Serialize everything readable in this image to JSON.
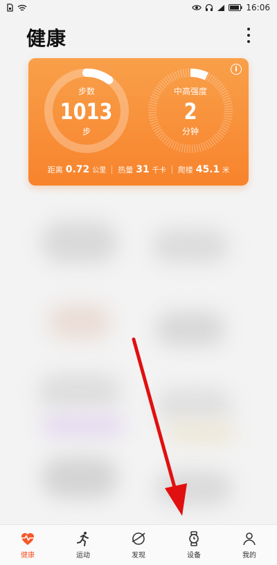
{
  "status_bar": {
    "time": "16:06"
  },
  "header": {
    "title": "健康"
  },
  "summary": {
    "steps": {
      "label": "步数",
      "value": "1013",
      "unit": "步",
      "progress": 0.1
    },
    "active": {
      "label": "中高强度",
      "value": "2",
      "unit": "分钟",
      "progress": 0.07
    },
    "stats": [
      {
        "label": "距离",
        "value": "0.72",
        "unit": "公里"
      },
      {
        "label": "热量",
        "value": "31",
        "unit": "千卡"
      },
      {
        "label": "爬楼",
        "value": "45.1",
        "unit": "米"
      }
    ]
  },
  "nav": {
    "items": [
      {
        "label": "健康",
        "icon": "heart-pulse-icon",
        "active": true
      },
      {
        "label": "运动",
        "icon": "running-icon",
        "active": false
      },
      {
        "label": "发现",
        "icon": "planet-icon",
        "active": false
      },
      {
        "label": "设备",
        "icon": "watch-icon",
        "active": false
      },
      {
        "label": "我的",
        "icon": "person-icon",
        "active": false
      }
    ]
  },
  "colors": {
    "accent": "#f5592c",
    "card_top": "#f9a04a",
    "card_bottom": "#f7832c",
    "arrow": "#e01010"
  }
}
